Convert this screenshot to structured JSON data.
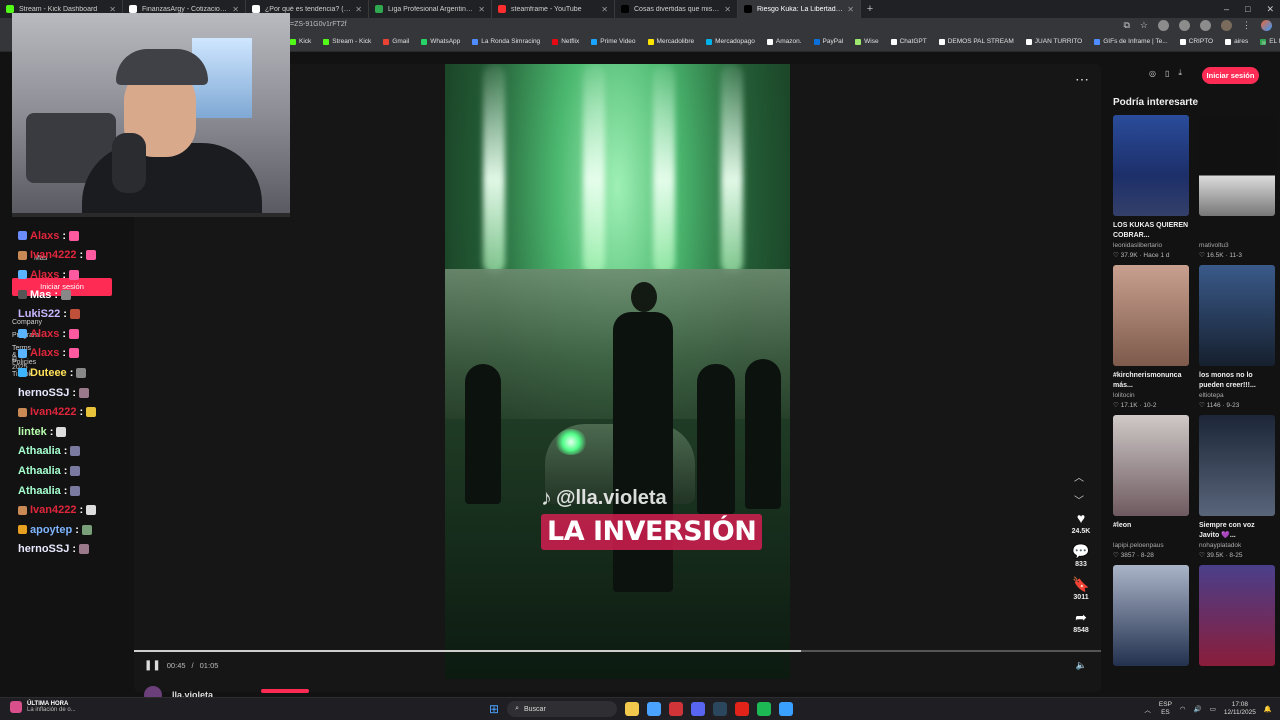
{
  "tabs": [
    {
      "title": "Stream - Kick Dashboard",
      "color": "#53fc18"
    },
    {
      "title": "FinanzasArgy - Cotizaciones en ti",
      "color": "#ffffff"
    },
    {
      "title": "¿Por qué es tendencia? (@porqu",
      "color": "#ffffff"
    },
    {
      "title": "Liga Profesional Argentina - POS",
      "color": "#2fa84f"
    },
    {
      "title": "steamframe - YouTube",
      "color": "#ff2d2d"
    },
    {
      "title": "Cosas divertidas que mis novios",
      "color": "#000000"
    },
    {
      "title": "Riesgo Kuka: La Libertad Av",
      "color": "#000000"
    }
  ],
  "url": "=ZS-91G0v1rFT2f",
  "window_controls": {
    "minimize": "–",
    "maximize": "□",
    "close": "✕"
  },
  "bookmarks": [
    {
      "label": "Kick",
      "color": "#53fc18"
    },
    {
      "label": "Stream - Kick",
      "color": "#53fc18"
    },
    {
      "label": "Gmail",
      "color": "#ea4335"
    },
    {
      "label": "WhatsApp",
      "color": "#25d366"
    },
    {
      "label": "La Ronda Simracing",
      "color": "#4e8cff"
    },
    {
      "label": "Netflix",
      "color": "#e50914"
    },
    {
      "label": "Prime Video",
      "color": "#1aa3ff"
    },
    {
      "label": "Mercadolibre",
      "color": "#ffe600"
    },
    {
      "label": "Mercadopago",
      "color": "#00b1ea"
    },
    {
      "label": "Amazon.",
      "color": "#ffffff"
    },
    {
      "label": "PayPal",
      "color": "#0a6fd8"
    },
    {
      "label": "Wise",
      "color": "#9fe870"
    },
    {
      "label": "ChatGPT",
      "color": "#ffffff"
    },
    {
      "label": "DEMOS PAL STREAM",
      "color": "#ffffff"
    },
    {
      "label": "JUAN TURRITO",
      "color": "#ffffff"
    },
    {
      "label": "GIFs de Inframe | Te...",
      "color": "#4e8cff"
    },
    {
      "label": "CRIPTO",
      "color": "#ffffff"
    },
    {
      "label": "aires",
      "color": "#ffffff"
    },
    {
      "label": "EL MEGA PACK PAP...",
      "color": "#2fa84f"
    }
  ],
  "video": {
    "handle": "@lla.violeta",
    "caption": "LA INVERSIÓN",
    "time_current": "00:45",
    "time_total": "01:05",
    "progress": 0.69,
    "author": "lla.violeta",
    "menu": "⋯",
    "likes": "24.5K",
    "comments": "833",
    "saves": "3011",
    "shares": "8548"
  },
  "right": {
    "login": "Iniciar sesión",
    "recommended_title": "Podría interesarte",
    "cards": [
      {
        "title": "LOS KUKAS QUIEREN COBRAR...",
        "user": "leonidaslibertario",
        "likes": "37.9K",
        "date": "Hace 1 d",
        "bg": "linear-gradient(180deg,#2a4c9a,#1d2f6a 60%,#34406a)"
      },
      {
        "title": "",
        "user": "mativoltu3",
        "likes": "16.5K",
        "date": "11-3",
        "bg": "linear-gradient(180deg,#111,#111 60%,#dcdcdc 60%,#777)"
      },
      {
        "title": "#kirchnerismonunca más...",
        "user": "lolitocin",
        "likes": "17.1K",
        "date": "10-2",
        "bg": "linear-gradient(180deg,#c9a08f,#7d5a4c)"
      },
      {
        "title": "los monos no lo pueden creer!!!...",
        "user": "eltiotepa",
        "likes": "1146",
        "date": "9-23",
        "bg": "linear-gradient(180deg,#3a5a8a,#16202e)"
      },
      {
        "title": "#leon",
        "user": "lapipi.peloenpaus",
        "likes": "3857",
        "date": "8-28",
        "bg": "linear-gradient(180deg,#cfc9c7,#6e5a60)"
      },
      {
        "title": "Siempre con voz Javito 💜...",
        "user": "nohayplatadok",
        "likes": "39.5K",
        "date": "8-25",
        "bg": "linear-gradient(180deg,#1c2638,#59657a)"
      },
      {
        "title": "",
        "user": "",
        "likes": "",
        "date": "",
        "bg": "linear-gradient(180deg,#aab4c8,#23314f)"
      },
      {
        "title": "",
        "user": "",
        "likes": "",
        "date": "",
        "bg": "linear-gradient(180deg,#4a3f8a,#8a1d3a)"
      }
    ]
  },
  "overlay": {
    "side_labels": [
      "Mas",
      "Company",
      "Program",
      "Terms & Policies",
      "© 2025 TikTok"
    ],
    "login": "Iniciar sesión"
  },
  "chat": [
    {
      "user": "Alaxs",
      "color": "#e0263c",
      "badge": "#6b8cff",
      "emote": "#ff5aa0"
    },
    {
      "user": "Ivan4222",
      "color": "#e0263c",
      "badge": "#c98a55",
      "emote": "#ff5aa0"
    },
    {
      "user": "Alaxs",
      "color": "#e0263c",
      "badge": "#5ab4ff",
      "emote": "#ff5aa0"
    },
    {
      "user": "Mas",
      "color": "#ffffff",
      "badge": "#555555",
      "emote": "#888888"
    },
    {
      "user": "LukiS22",
      "color": "#c9b6ff",
      "badge": "",
      "emote": "#c0503a"
    },
    {
      "user": "Alaxs",
      "color": "#e0263c",
      "badge": "#5ab4ff",
      "emote": "#ff5aa0"
    },
    {
      "user": "Alaxs",
      "color": "#e0263c",
      "badge": "#5ab4ff",
      "emote": "#ff5aa0"
    },
    {
      "user": "Duteee",
      "color": "#ffe15a",
      "badge": "#3cb4ff",
      "emote": "#888888"
    },
    {
      "user": "hernoSSJ",
      "color": "#e8e8ff",
      "badge": "",
      "emote": "#9a7a8a"
    },
    {
      "user": "Ivan4222",
      "color": "#e0263c",
      "badge": "#c98a55",
      "emote": "#e8c23a"
    },
    {
      "user": "lintek",
      "color": "#b9ffb0",
      "badge": "",
      "emote": "#dddddd"
    },
    {
      "user": "Athaalia",
      "color": "#a6ffcf",
      "badge": "",
      "emote": "#7a7aa0"
    },
    {
      "user": "Athaalia",
      "color": "#a6ffcf",
      "badge": "",
      "emote": "#7a7aa0"
    },
    {
      "user": "Athaalia",
      "color": "#a6ffcf",
      "badge": "",
      "emote": "#7a7aa0"
    },
    {
      "user": "Ivan4222",
      "color": "#e0263c",
      "badge": "#c98a55",
      "emote": "#dddddd"
    },
    {
      "user": "apoytep",
      "color": "#7fb4ff",
      "badge": "#e8a020",
      "emote": "#7aa07a"
    },
    {
      "user": "hernoSSJ",
      "color": "#e8e8ff",
      "badge": "",
      "emote": "#9a7a8a"
    }
  ],
  "taskbar": {
    "news_title": "ÚLTIMA HORA",
    "news_text": "La inflación de o...",
    "search": "Buscar",
    "lang_1": "ESP",
    "lang_2": "ES",
    "time": "17:08",
    "date": "12/11/2025",
    "apps": [
      "#f2c94c",
      "#4aa3ff",
      "#d13438",
      "#5865f2",
      "#2a475e",
      "#e2231a",
      "#1db954",
      "#3aa0ff"
    ]
  }
}
